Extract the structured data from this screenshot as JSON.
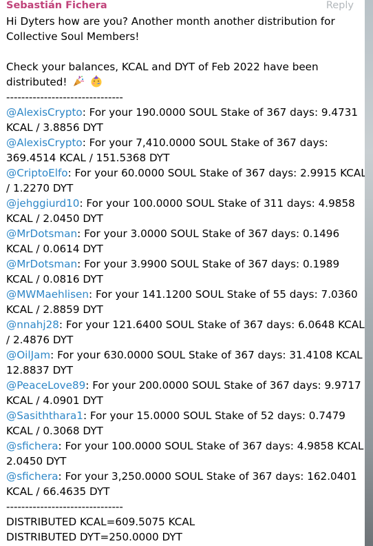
{
  "message": {
    "sender": "Sebastián Fichera",
    "reply_label": "Reply",
    "greeting_lines": [
      "Hi Dyters how are you? Another month another distribution for",
      "Collective Soul Members!"
    ],
    "check_lines": [
      "Check your balances, KCAL and DYT of Feb 2022 have been",
      "distributed!"
    ],
    "emojis": [
      "party-popper-icon",
      "partying-face-icon"
    ],
    "separator": "-------------------------------",
    "entries": [
      {
        "mention": "@AlexisCrypto",
        "line1": ": For your 190.0000 SOUL Stake of 367 days: 9.4731",
        "line2": "KCAL / 3.8856 DYT"
      },
      {
        "mention": "@AlexisCrypto",
        "line1": ": For your 7,410.0000 SOUL Stake of 367 days:",
        "line2": "369.4514 KCAL / 151.5368 DYT"
      },
      {
        "mention": "@CriptoElfo",
        "line1": ": For your 60.0000 SOUL Stake of 367 days: 2.9915 KCAL",
        "line2": "/ 1.2270 DYT"
      },
      {
        "mention": "@jehggiurd10",
        "line1": ": For your 100.0000 SOUL Stake of 311 days: 4.9858",
        "line2": "KCAL / 2.0450 DYT"
      },
      {
        "mention": "@MrDotsman",
        "line1": ": For your 3.0000 SOUL Stake of 367 days: 0.1496",
        "line2": "KCAL / 0.0614 DYT"
      },
      {
        "mention": "@MrDotsman",
        "line1": ": For your 3.9900 SOUL Stake of 367 days: 0.1989",
        "line2": "KCAL / 0.0816 DYT"
      },
      {
        "mention": "@MWMaehlisen",
        "line1": ": For your 141.1200 SOUL Stake of 55 days: 7.0360",
        "line2": "KCAL / 2.8859 DYT"
      },
      {
        "mention": "@nnahj28",
        "line1": ": For your 121.6400 SOUL Stake of 367 days: 6.0648 KCAL",
        "line2": "/ 2.4876 DYT"
      },
      {
        "mention": "@OilJam",
        "line1": ": For your 630.0000 SOUL Stake of 367 days: 31.4108 KCAL /",
        "line2": "12.8837 DYT"
      },
      {
        "mention": "@PeaceLove89",
        "line1": ": For your 200.0000 SOUL Stake of 367 days: 9.9717",
        "line2": "KCAL / 4.0901 DYT"
      },
      {
        "mention": "@Sasiththara1",
        "line1": ": For your 15.0000 SOUL Stake of 52 days: 0.7479",
        "line2": "KCAL / 0.3068 DYT"
      },
      {
        "mention": "@sfichera",
        "line1": ": For your 100.0000 SOUL Stake of 367 days: 4.9858 KCAL /",
        "line2": "2.0450 DYT"
      },
      {
        "mention": "@sfichera",
        "line1": ": For your 3,250.0000 SOUL Stake of 367 days: 162.0401",
        "line2": "KCAL / 66.4635 DYT"
      }
    ],
    "totals": [
      "DISTRIBUTED KCAL=609.5075 KCAL",
      "DISTRIBUTED DYT=250.0000 DYT"
    ]
  }
}
